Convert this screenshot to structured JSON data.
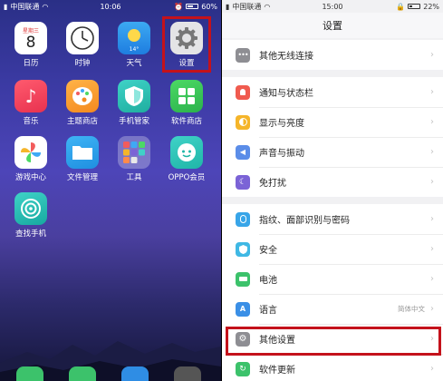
{
  "home": {
    "status": {
      "carrier": "中国联通",
      "time": "10:06",
      "battery": "60%"
    },
    "apps": [
      {
        "name": "calendar",
        "label": "日历",
        "weekday": "星期三",
        "day": "8"
      },
      {
        "name": "clock",
        "label": "时钟"
      },
      {
        "name": "weather",
        "label": "天气",
        "temp": "14°"
      },
      {
        "name": "settings",
        "label": "设置"
      },
      {
        "name": "music",
        "label": "音乐"
      },
      {
        "name": "theme-store",
        "label": "主题商店"
      },
      {
        "name": "phone-manager",
        "label": "手机管家"
      },
      {
        "name": "app-store",
        "label": "软件商店"
      },
      {
        "name": "game-center",
        "label": "游戏中心"
      },
      {
        "name": "file-manager",
        "label": "文件管理"
      },
      {
        "name": "tools",
        "label": "工具"
      },
      {
        "name": "oppo-member",
        "label": "OPPO会员"
      },
      {
        "name": "find-phone",
        "label": "查找手机"
      }
    ]
  },
  "settings": {
    "status": {
      "carrier": "中国联通",
      "time": "15:00",
      "battery": "22%"
    },
    "title": "设置",
    "groups": [
      [
        {
          "key": "wireless",
          "label": "其他无线连接",
          "icon": "more-dots-icon",
          "color": "#8e8e93"
        }
      ],
      [
        {
          "key": "notifications",
          "label": "通知与状态栏",
          "icon": "notification-icon",
          "color": "#f05b4f"
        },
        {
          "key": "display",
          "label": "显示与亮度",
          "icon": "brightness-icon",
          "color": "#f5b52a"
        },
        {
          "key": "sound",
          "label": "声音与振动",
          "icon": "speaker-icon",
          "color": "#5b8de8"
        },
        {
          "key": "dnd",
          "label": "免打扰",
          "icon": "moon-icon",
          "color": "#7b63d6"
        }
      ],
      [
        {
          "key": "biometric",
          "label": "指纹、面部识别与密码",
          "icon": "fingerprint-icon",
          "color": "#38a5e8"
        },
        {
          "key": "security",
          "label": "安全",
          "icon": "shield-icon",
          "color": "#3fb8e4"
        },
        {
          "key": "battery",
          "label": "电池",
          "icon": "battery-icon",
          "color": "#3cc26b"
        },
        {
          "key": "language",
          "label": "语言",
          "value": "简体中文",
          "icon": "language-icon",
          "color": "#3a8fe6"
        },
        {
          "key": "other",
          "label": "其他设置",
          "icon": "gear-icon",
          "color": "#8e8e93"
        },
        {
          "key": "update",
          "label": "软件更新",
          "icon": "update-icon",
          "color": "#3cc26b"
        }
      ]
    ]
  },
  "colors": {
    "highlight": "#c4121b"
  }
}
